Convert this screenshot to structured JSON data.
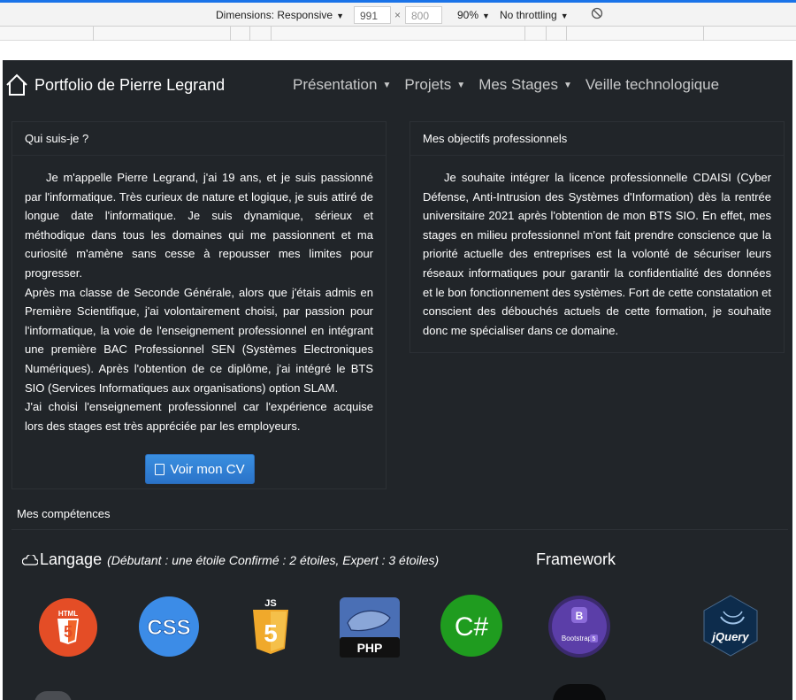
{
  "devtools": {
    "dimensions_label": "Dimensions: Responsive",
    "width": "991",
    "height": "800",
    "times_sign": "×",
    "zoom": "90%",
    "throttling": "No throttling"
  },
  "navbar": {
    "brand": "Portfolio de Pierre Legrand",
    "items": [
      {
        "label": "Présentation",
        "dropdown": true
      },
      {
        "label": "Projets",
        "dropdown": true
      },
      {
        "label": "Mes Stages",
        "dropdown": true
      },
      {
        "label": "Veille technologique",
        "dropdown": false
      }
    ]
  },
  "about": {
    "title": "Qui suis-je ?",
    "paragraphs": [
      "Je m'appelle Pierre Legrand, j'ai 19 ans, et je suis passionné par l'informatique. Très curieux de nature et logique, je suis attiré de longue date l'informatique. Je suis dynamique, sérieux et méthodique dans tous les domaines qui me passionnent et ma curiosité m'amène sans cesse à repousser mes limites pour progresser.",
      "Après ma classe de Seconde Générale, alors que j'étais admis en Première Scientifique, j'ai volontairement choisi, par passion pour l'informatique, la voie de l'enseignement professionnel en intégrant une première BAC Professionnel SEN (Systèmes Electroniques Numériques). Après l'obtention de ce diplôme, j'ai intégré le BTS SIO (Services Informatiques aux organisations) option SLAM.",
      "J'ai choisi l'enseignement professionnel car l'expérience acquise lors des stages est très appréciée par les employeurs."
    ],
    "cv_button": "Voir mon CV"
  },
  "objectives": {
    "title": "Mes objectifs professionnels",
    "paragraph": "Je souhaite intégrer la licence professionnelle CDAISI (Cyber Défense, Anti-Intrusion des Systèmes d'Information) dès la rentrée universitaire 2021 après l'obtention de mon BTS SIO. En effet, mes stages en milieu professionnel m'ont fait prendre conscience que la priorité actuelle des entreprises est la volonté de sécuriser leurs réseaux informatiques pour garantir la confidentialité des données et le bon fonctionnement des systèmes. Fort de cette constatation et conscient des débouchés actuels de cette formation, je souhaite donc me spécialiser dans ce domaine."
  },
  "skills": {
    "title": "Mes compétences",
    "languages_title": "Langage",
    "languages_note": "(Débutant : une étoile Confirmé : 2 étoiles, Expert : 3 étoiles)",
    "framework_title": "Framework",
    "logos": {
      "html": "HTML",
      "css": "CSS",
      "js": "JS",
      "php": "PHP",
      "csharp": "C#",
      "bootstrap": "Bootstrap",
      "bootstrap_ver": "5",
      "jquery": "jQuery"
    }
  },
  "colors": {
    "background": "#212529",
    "html": "#e44d26",
    "css": "#3c8ce7",
    "js": "#f0a92b",
    "php": "#4a6fb5",
    "csharp": "#1f9c1f",
    "bootstrap": "#6f42c1",
    "jquery": "#0d2c4c",
    "button": "#2a73c9"
  }
}
